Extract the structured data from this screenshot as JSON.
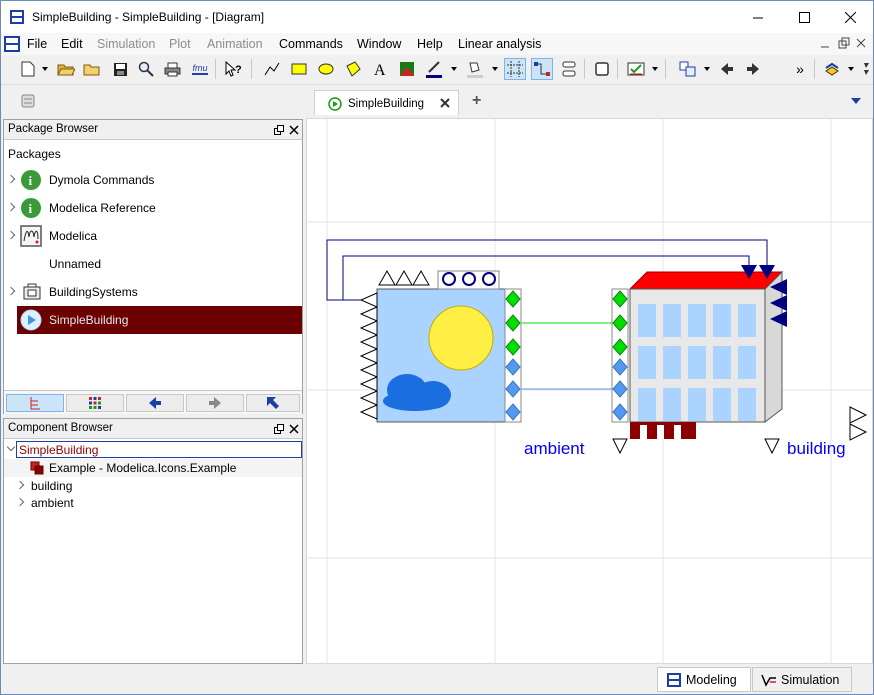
{
  "window": {
    "title": "SimpleBuilding - SimpleBuilding  - [Diagram]"
  },
  "menubar": {
    "items": [
      {
        "label": "File",
        "disabled": false
      },
      {
        "label": "Edit",
        "disabled": false
      },
      {
        "label": "Simulation",
        "disabled": true
      },
      {
        "label": "Plot",
        "disabled": true
      },
      {
        "label": "Animation",
        "disabled": true
      },
      {
        "label": "Commands",
        "disabled": false
      },
      {
        "label": "Window",
        "disabled": false
      },
      {
        "label": "Help",
        "disabled": false
      },
      {
        "label": "Linear analysis",
        "disabled": false
      }
    ]
  },
  "toolbar": {
    "icons": [
      "new-file-icon",
      "open-icon",
      "open-folder-icon",
      "save-icon",
      "search-icon",
      "print-icon",
      "fmu-icon",
      "whats-this-icon",
      "line-tool-icon",
      "rectangle-tool-icon",
      "ellipse-tool-icon",
      "polygon-tool-icon",
      "text-tool-icon",
      "bitmap-tool-icon",
      "line-color-icon",
      "fill-color-icon",
      "grid-toggle-icon",
      "connect-mode-icon",
      "manhattanize-icon",
      "rectangle-select-icon",
      "check-icon",
      "diagram-view-icon",
      "back-icon",
      "forward-icon",
      "more-icon",
      "library-icon"
    ],
    "fmu_label": "fmu",
    "more_label": "»"
  },
  "tabs": {
    "items": [
      {
        "label": "SimpleBuilding",
        "active": true
      }
    ],
    "add_label": "+"
  },
  "package_browser": {
    "title": "Package Browser",
    "root_label": "Packages",
    "items": [
      {
        "label": "Dymola Commands",
        "icon": "info-icon",
        "expandable": true,
        "selected": false
      },
      {
        "label": "Modelica Reference",
        "icon": "info-icon",
        "expandable": true,
        "selected": false
      },
      {
        "label": "Modelica",
        "icon": "modelica-icon",
        "expandable": true,
        "selected": false
      },
      {
        "label": "Unnamed",
        "icon": "",
        "expandable": false,
        "selected": false
      },
      {
        "label": "BuildingSystems",
        "icon": "package-icon",
        "expandable": true,
        "selected": false
      },
      {
        "label": "SimpleBuilding",
        "icon": "example-run-icon",
        "expandable": false,
        "selected": true
      }
    ]
  },
  "component_browser": {
    "title": "Component Browser",
    "root": "SimpleBuilding",
    "extends": "Example - Modelica.Icons.Example",
    "items": [
      "building",
      "ambient"
    ]
  },
  "diagram": {
    "components": [
      {
        "name": "ambient",
        "type": "weather",
        "label": "ambient"
      },
      {
        "name": "building",
        "type": "building",
        "label": "building"
      }
    ],
    "colors": {
      "label": "#0000ff",
      "heat_port": "#00ff00",
      "signal": "#5599ee",
      "connection_line": "#000080",
      "sky": "#aad4ff",
      "sun": "#ffee44",
      "roof": "#ff0000",
      "window": "#aad4ff"
    }
  },
  "status": {
    "modes": [
      {
        "label": "Modeling",
        "active": true,
        "icon": "modeling-icon"
      },
      {
        "label": "Simulation",
        "active": false,
        "icon": "simulation-icon"
      }
    ]
  }
}
